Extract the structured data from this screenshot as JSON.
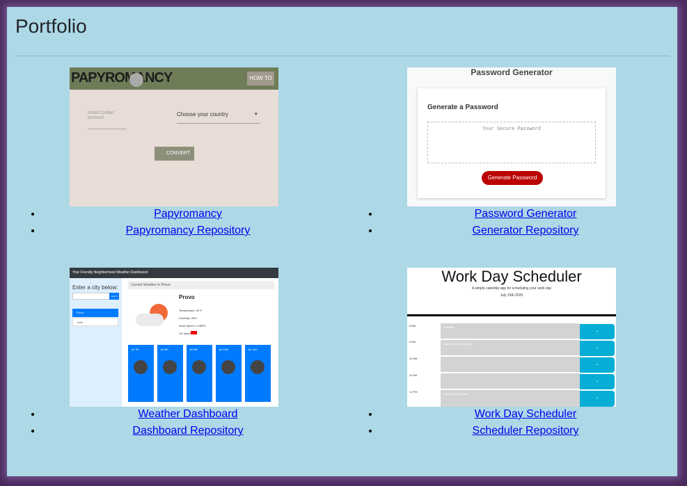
{
  "page": {
    "title": "Portfolio"
  },
  "projects": [
    {
      "app_link": "Papyromancy",
      "repo_link": "Papyromancy Repository",
      "preview": {
        "logo": "PAPYROMANCY",
        "nav_button": "HOW TO",
        "input_placeholder": "Insert Dollar amount",
        "select_value": "Choose your country",
        "convert_button": "CONVERT"
      }
    },
    {
      "app_link": "Password Generator",
      "repo_link": "Generator Repository",
      "preview": {
        "heading": "Password Generator",
        "card_title": "Generate a Password",
        "textarea_placeholder": "Your Secure Password",
        "button": "Generate Password"
      }
    },
    {
      "app_link": "Weather Dashboard",
      "repo_link": "Dashboard Repository",
      "preview": {
        "header": "Your Friendly Neighborhood Weather Dashboard",
        "search_label": "Enter a city below:",
        "search_button": "search",
        "city_list": [
          "Provo",
          "Lehi"
        ],
        "current_label": "Current Weather in Provo",
        "city": "Provo",
        "details": [
          "Temperature: 84°F",
          "Humidity: 28%",
          "Wind Speed: 2.2MPH",
          "UV Index:"
        ],
        "forecast": [
          "Jul 7th",
          "Jul 8th",
          "Jul 9th",
          "Jul 10th",
          "Jul 11th"
        ]
      }
    },
    {
      "app_link": "Work Day Scheduler",
      "repo_link": "Scheduler Repository",
      "preview": {
        "title": "Work Day Scheduler",
        "subtitle": "A simple calendar app for scheduling your work day",
        "date": "July 15th 2020",
        "hours": [
          "8 AM",
          "9 AM",
          "10 AM",
          "11 AM",
          "12 PM"
        ],
        "entries": [
          "Exercise",
          "Early Morning Meeting",
          "",
          "",
          "Lunch with Business"
        ]
      }
    }
  ]
}
